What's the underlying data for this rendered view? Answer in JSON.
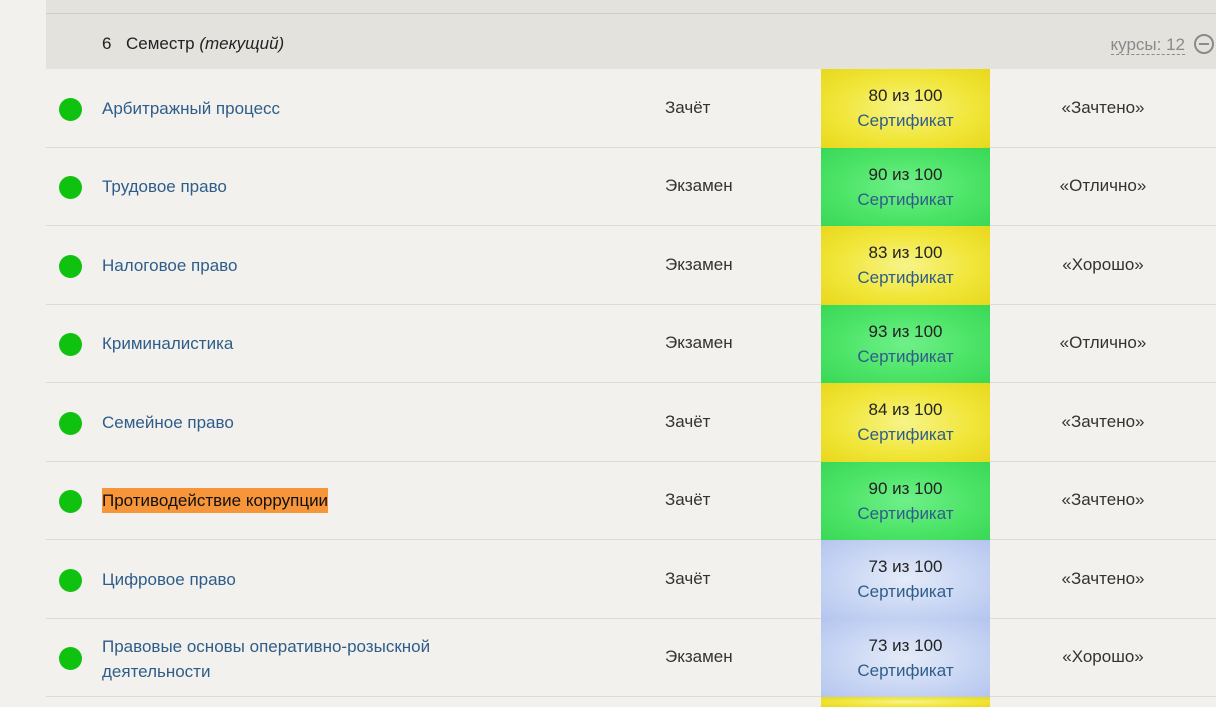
{
  "semester": {
    "number": "6",
    "title": "Семестр",
    "current_label": "(текущий)",
    "courses_label": "курсы: 12"
  },
  "certificate_label": "Сертификат",
  "score_colors": {
    "yellow": "#f1e63a",
    "green": "#4de468",
    "blue": "#c9d6f4"
  },
  "courses": [
    {
      "name": "Арбитражный процесс",
      "control": "Зачёт",
      "score": "80 из 100",
      "grade": "«Зачтено»",
      "color": "yellow",
      "highlighted": false
    },
    {
      "name": "Трудовое право",
      "control": "Экзамен",
      "score": "90 из 100",
      "grade": "«Отлично»",
      "color": "green",
      "highlighted": false
    },
    {
      "name": "Налоговое право",
      "control": "Экзамен",
      "score": "83 из 100",
      "grade": "«Хорошо»",
      "color": "yellow",
      "highlighted": false
    },
    {
      "name": "Криминалистика",
      "control": "Экзамен",
      "score": "93 из 100",
      "grade": "«Отлично»",
      "color": "green",
      "highlighted": false
    },
    {
      "name": "Семейное право",
      "control": "Зачёт",
      "score": "84 из 100",
      "grade": "«Зачтено»",
      "color": "yellow",
      "highlighted": false
    },
    {
      "name": "Противодействие коррупции",
      "control": "Зачёт",
      "score": "90 из 100",
      "grade": "«Зачтено»",
      "color": "green",
      "highlighted": true
    },
    {
      "name": "Цифровое право",
      "control": "Зачёт",
      "score": "73 из 100",
      "grade": "«Зачтено»",
      "color": "blue",
      "highlighted": false
    },
    {
      "name": "Правовые основы оперативно-розыскной деятельности",
      "control": "Экзамен",
      "score": "73 из 100",
      "grade": "«Хорошо»",
      "color": "blue",
      "highlighted": false
    }
  ],
  "next_row_color": "yellow"
}
